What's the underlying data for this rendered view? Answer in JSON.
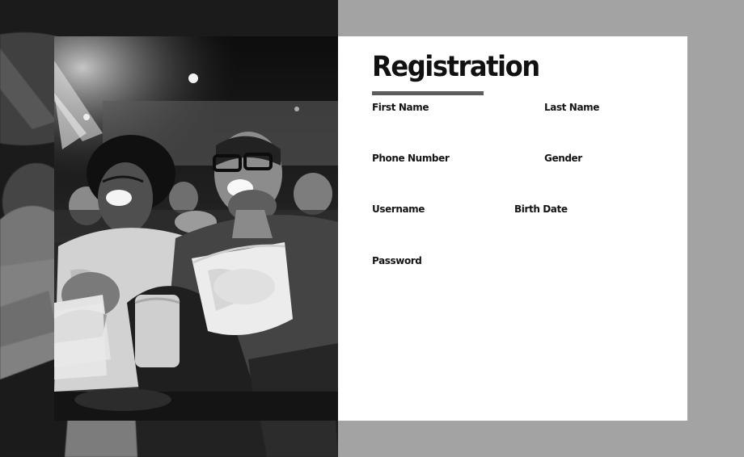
{
  "form": {
    "title": "Registration",
    "fields": {
      "first_name": {
        "label": "First Name",
        "value": ""
      },
      "last_name": {
        "label": "Last Name",
        "value": ""
      },
      "phone_number": {
        "label": "Phone Number",
        "value": ""
      },
      "gender": {
        "label": "Gender",
        "value": ""
      },
      "username": {
        "label": "Username",
        "value": ""
      },
      "birth_date": {
        "label": "Birth Date",
        "value": ""
      },
      "password": {
        "label": "Password",
        "value": ""
      }
    }
  },
  "colors": {
    "page_background": "#a3a3a3",
    "card_background": "#ffffff",
    "title_text": "#111111",
    "title_underline": "#5c5c5c"
  },
  "photo": {
    "subject": "two-men-laughing-in-cinema-with-popcorn"
  }
}
